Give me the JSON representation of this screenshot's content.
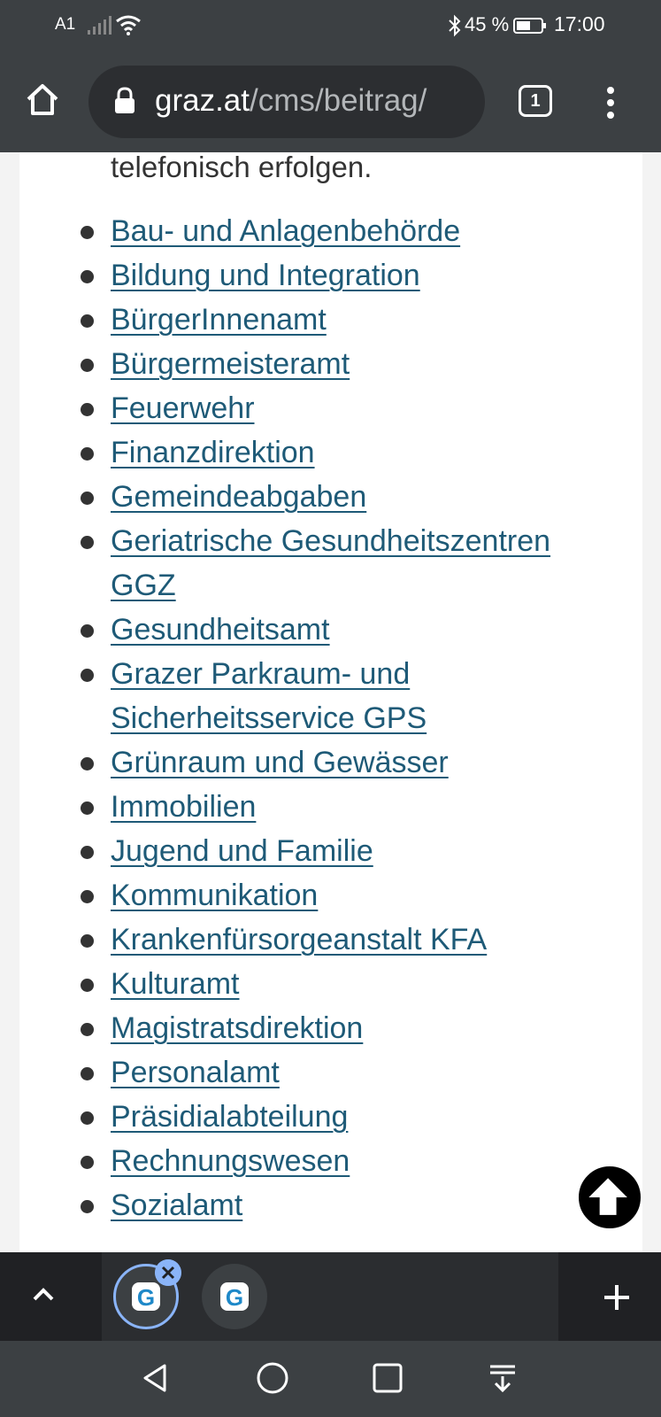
{
  "status_bar": {
    "carrier": "A1",
    "battery_percent": "45 %",
    "time": "17:00",
    "icons": [
      "signal-icon",
      "wifi-icon",
      "bluetooth-icon",
      "battery-icon"
    ]
  },
  "browser": {
    "url_host": "graz.at",
    "url_path": "/cms/beitrag/",
    "tab_count": "1"
  },
  "page": {
    "intro_text": "telefonisch erfolgen.",
    "links": [
      {
        "label": "Bau- und Anlagenbehörde"
      },
      {
        "label": "Bildung und Integration"
      },
      {
        "label": "BürgerInnenamt"
      },
      {
        "label": "Bürgermeisteramt"
      },
      {
        "label": "Feuerwehr"
      },
      {
        "label": "Finanzdirektion"
      },
      {
        "label": "Gemeindeabgaben"
      },
      {
        "label": "Geriatrische Gesundheitszentren",
        "label2": "GGZ"
      },
      {
        "label": "Gesundheitsamt"
      },
      {
        "label": "Grazer Parkraum- und",
        "label2": "Sicherheitsservice GPS"
      },
      {
        "label": "Grünraum und Gewässer"
      },
      {
        "label": "Immobilien"
      },
      {
        "label": "Jugend und Familie"
      },
      {
        "label": "Kommunikation"
      },
      {
        "label": "Krankenfürsorgeanstalt KFA"
      },
      {
        "label": "Kulturamt"
      },
      {
        "label": "Magistratsdirektion"
      },
      {
        "label": "Personalamt"
      },
      {
        "label": "Präsidialabteilung"
      },
      {
        "label": "Rechnungswesen"
      },
      {
        "label": "Sozialamt"
      }
    ]
  },
  "tab_switcher": {
    "tab_icon_letter": "G",
    "accent_color": "#8ab4f8"
  },
  "colors": {
    "link": "#1e5a77",
    "chrome_bg": "#3c4043"
  }
}
